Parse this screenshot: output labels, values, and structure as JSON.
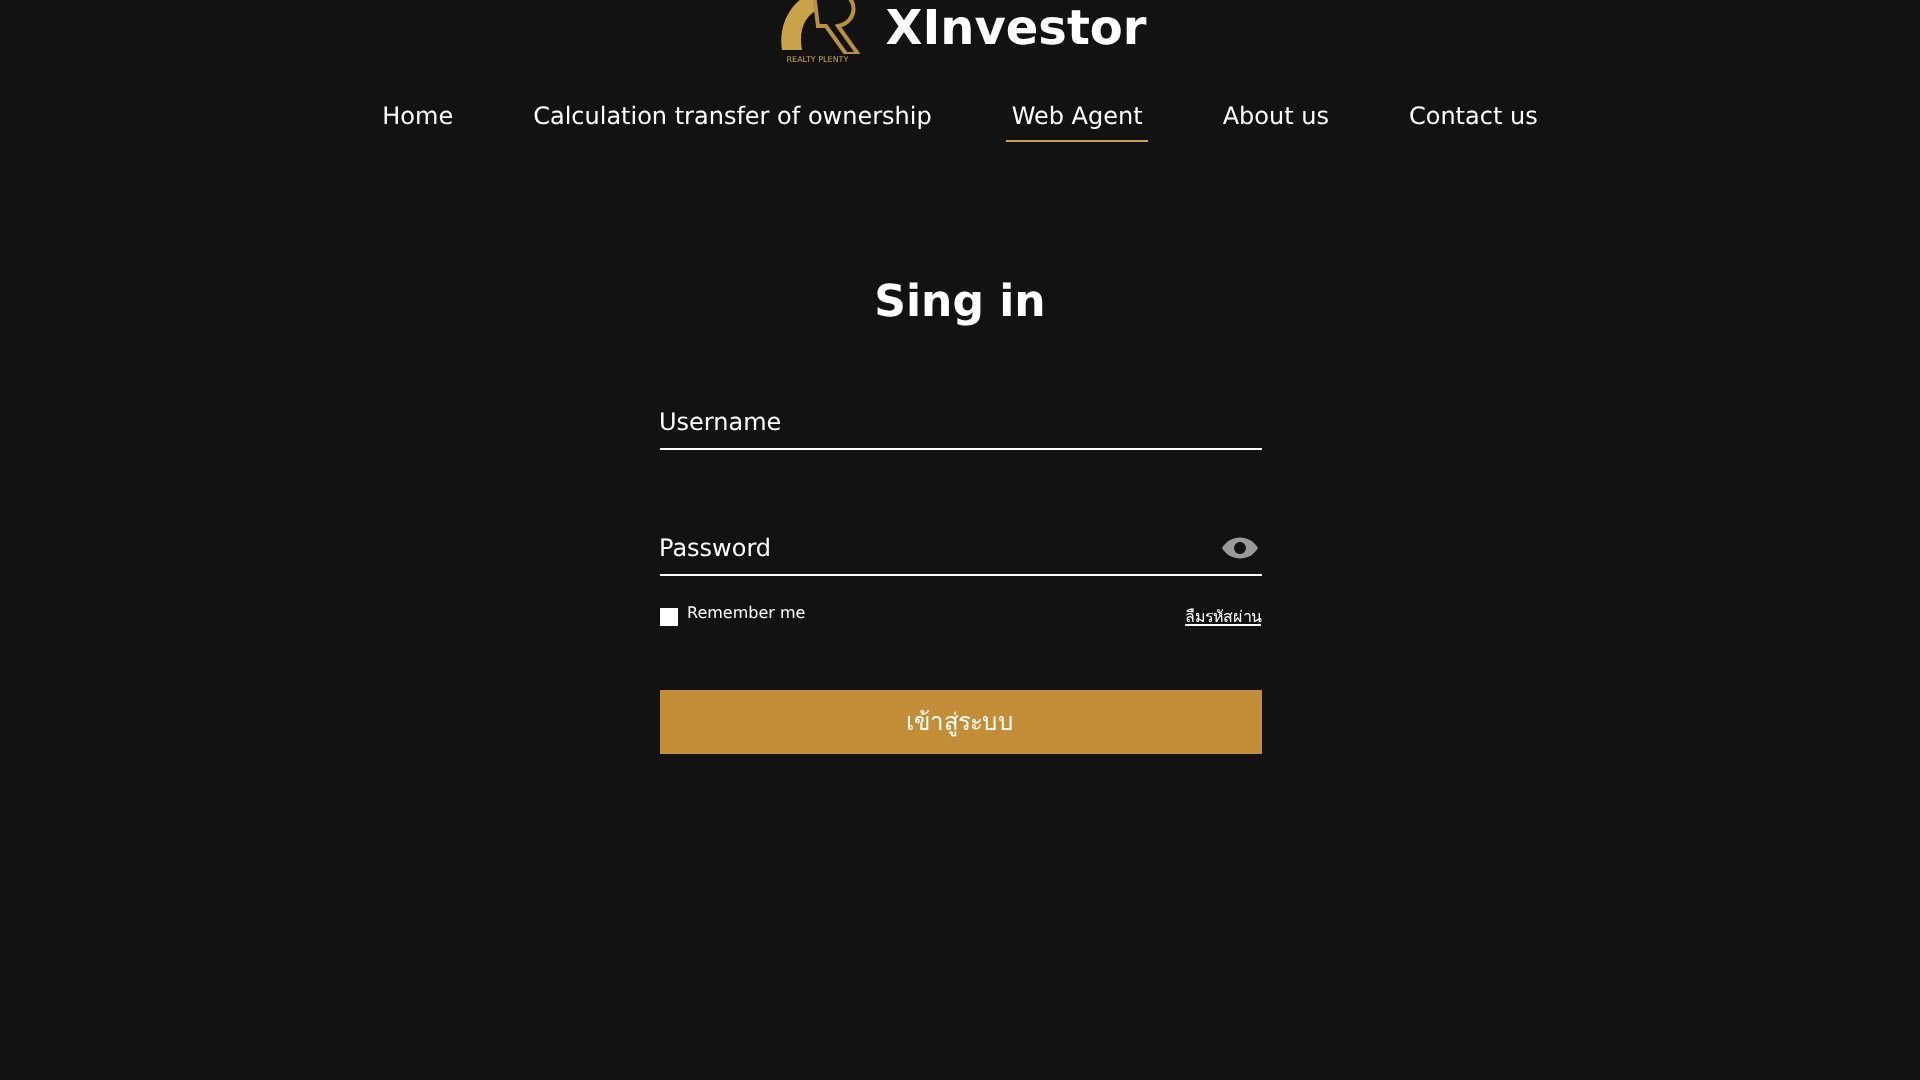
{
  "logo": {
    "tagline": "REALTY PLENTY",
    "name": "XInvestor"
  },
  "nav": [
    {
      "label": "Home",
      "selected": false
    },
    {
      "label": "Calculation transfer of ownership",
      "selected": false
    },
    {
      "label": "Web Agent",
      "selected": true
    },
    {
      "label": "About us",
      "selected": false
    },
    {
      "label": "Contact us",
      "selected": false
    }
  ],
  "form": {
    "title": "Sing in",
    "username": {
      "placeholder": "Username"
    },
    "password": {
      "placeholder": "Password"
    },
    "remember": {
      "label": "Remember me",
      "checked": false
    },
    "forgot": "ลืมรหัสผ่าน",
    "submit": "เข้าสู่ระบบ"
  }
}
